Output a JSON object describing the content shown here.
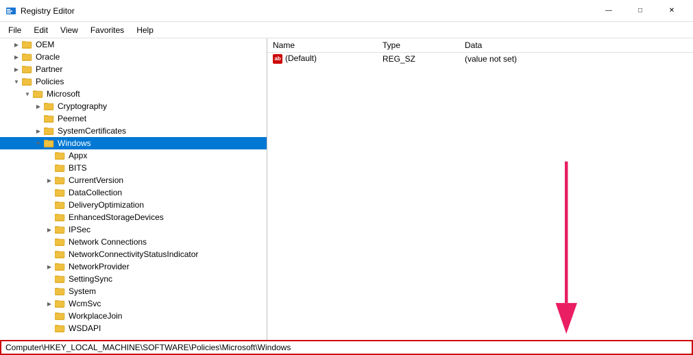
{
  "titleBar": {
    "icon": "regedit",
    "title": "Registry Editor",
    "controls": {
      "minimize": "—",
      "maximize": "□",
      "close": "✕"
    }
  },
  "menuBar": {
    "items": [
      "File",
      "Edit",
      "View",
      "Favorites",
      "Help"
    ]
  },
  "treeNodes": [
    {
      "id": "oem",
      "label": "OEM",
      "indent": 1,
      "state": "collapsed",
      "selected": false
    },
    {
      "id": "oracle",
      "label": "Oracle",
      "indent": 1,
      "state": "collapsed",
      "selected": false
    },
    {
      "id": "partner",
      "label": "Partner",
      "indent": 1,
      "state": "collapsed",
      "selected": false
    },
    {
      "id": "policies",
      "label": "Policies",
      "indent": 1,
      "state": "expanded",
      "selected": false
    },
    {
      "id": "microsoft",
      "label": "Microsoft",
      "indent": 2,
      "state": "expanded",
      "selected": false
    },
    {
      "id": "cryptography",
      "label": "Cryptography",
      "indent": 3,
      "state": "collapsed",
      "selected": false
    },
    {
      "id": "peernet",
      "label": "Peernet",
      "indent": 3,
      "state": "leaf",
      "selected": false
    },
    {
      "id": "systemcertificates",
      "label": "SystemCertificates",
      "indent": 3,
      "state": "collapsed",
      "selected": false
    },
    {
      "id": "windows",
      "label": "Windows",
      "indent": 3,
      "state": "expanded",
      "selected": true
    },
    {
      "id": "appx",
      "label": "Appx",
      "indent": 4,
      "state": "leaf",
      "selected": false
    },
    {
      "id": "bits",
      "label": "BITS",
      "indent": 4,
      "state": "leaf",
      "selected": false
    },
    {
      "id": "currentversion",
      "label": "CurrentVersion",
      "indent": 4,
      "state": "collapsed",
      "selected": false
    },
    {
      "id": "datacollection",
      "label": "DataCollection",
      "indent": 4,
      "state": "leaf",
      "selected": false
    },
    {
      "id": "deliveryoptimization",
      "label": "DeliveryOptimization",
      "indent": 4,
      "state": "leaf",
      "selected": false
    },
    {
      "id": "enhancedstoragedevices",
      "label": "EnhancedStorageDevices",
      "indent": 4,
      "state": "leaf",
      "selected": false
    },
    {
      "id": "ipsec",
      "label": "IPSec",
      "indent": 4,
      "state": "collapsed",
      "selected": false
    },
    {
      "id": "networkconnections",
      "label": "Network Connections",
      "indent": 4,
      "state": "leaf",
      "selected": false
    },
    {
      "id": "networkconnectivitystatusindicator",
      "label": "NetworkConnectivityStatusIndicator",
      "indent": 4,
      "state": "leaf",
      "selected": false
    },
    {
      "id": "networkprovider",
      "label": "NetworkProvider",
      "indent": 4,
      "state": "collapsed",
      "selected": false
    },
    {
      "id": "settingsync",
      "label": "SettingSync",
      "indent": 4,
      "state": "leaf",
      "selected": false
    },
    {
      "id": "system",
      "label": "System",
      "indent": 4,
      "state": "leaf",
      "selected": false
    },
    {
      "id": "wcmsvc",
      "label": "WcmSvc",
      "indent": 4,
      "state": "collapsed",
      "selected": false
    },
    {
      "id": "workplacejoin",
      "label": "WorkplaceJoin",
      "indent": 4,
      "state": "leaf",
      "selected": false
    },
    {
      "id": "wsdapi",
      "label": "WSDAPI",
      "indent": 4,
      "state": "leaf",
      "selected": false
    }
  ],
  "tableColumns": [
    "Name",
    "Type",
    "Data"
  ],
  "tableRows": [
    {
      "name": "(Default)",
      "type": "REG_SZ",
      "data": "(value not set)",
      "hasIcon": true
    }
  ],
  "statusBar": {
    "path": "Computer\\HKEY_LOCAL_MACHINE\\SOFTWARE\\Policies\\Microsoft\\Windows"
  }
}
